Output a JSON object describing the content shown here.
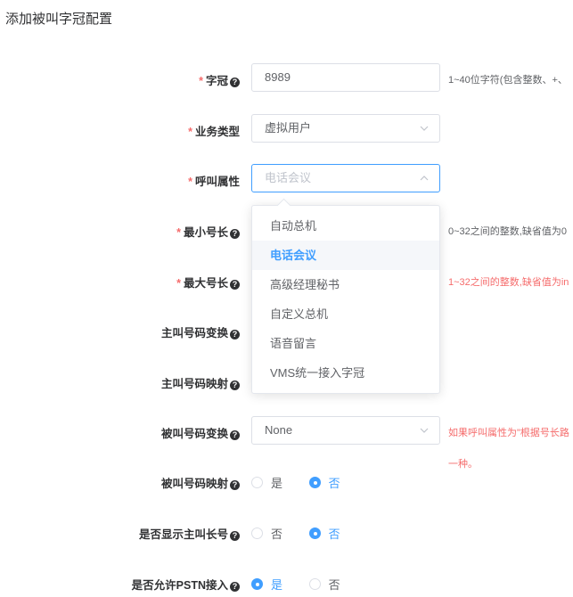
{
  "title": "添加被叫字冠配置",
  "fields": {
    "prefix": {
      "required_mark": "*",
      "label": "字冠",
      "value": "8989",
      "hint": "1~40位字符(包含整数、+、"
    },
    "service_type": {
      "required_mark": "*",
      "label": "业务类型",
      "value": "虚拟用户"
    },
    "call_attr": {
      "required_mark": "*",
      "label": "呼叫属性",
      "placeholder": "电话会议"
    },
    "min_len": {
      "required_mark": "*",
      "label": "最小号长",
      "hint": "0~32之间的整数,缺省值为0"
    },
    "max_len": {
      "required_mark": "*",
      "label": "最大号长",
      "hint": "1~32之间的整数,缺省值为in"
    },
    "caller_transform": {
      "label": "主叫号码变换"
    },
    "caller_mapping": {
      "label": "主叫号码映射"
    },
    "callee_transform": {
      "label": "被叫号码变换",
      "value": "None",
      "hint": "如果呼叫属性为\"根据号长路",
      "hint2": "一种。"
    },
    "callee_mapping": {
      "label": "被叫号码映射",
      "options": [
        "是",
        "否"
      ],
      "selected": "否"
    },
    "show_caller_long": {
      "label": "是否显示主叫长号",
      "options": [
        "否",
        "否"
      ],
      "selected_index": 1
    },
    "allow_pstn": {
      "label": "是否允许PSTN接入",
      "options": [
        "是",
        "否"
      ],
      "selected_index": 0
    }
  },
  "dropdown": {
    "options": [
      "自动总机",
      "电话会议",
      "高级经理秘书",
      "自定义总机",
      "语音留言",
      "VMS统一接入字冠"
    ],
    "selected": "电话会议"
  },
  "colors": {
    "accent": "#409eff",
    "required": "#f56c6c",
    "hint_error": "#f56c6c"
  }
}
